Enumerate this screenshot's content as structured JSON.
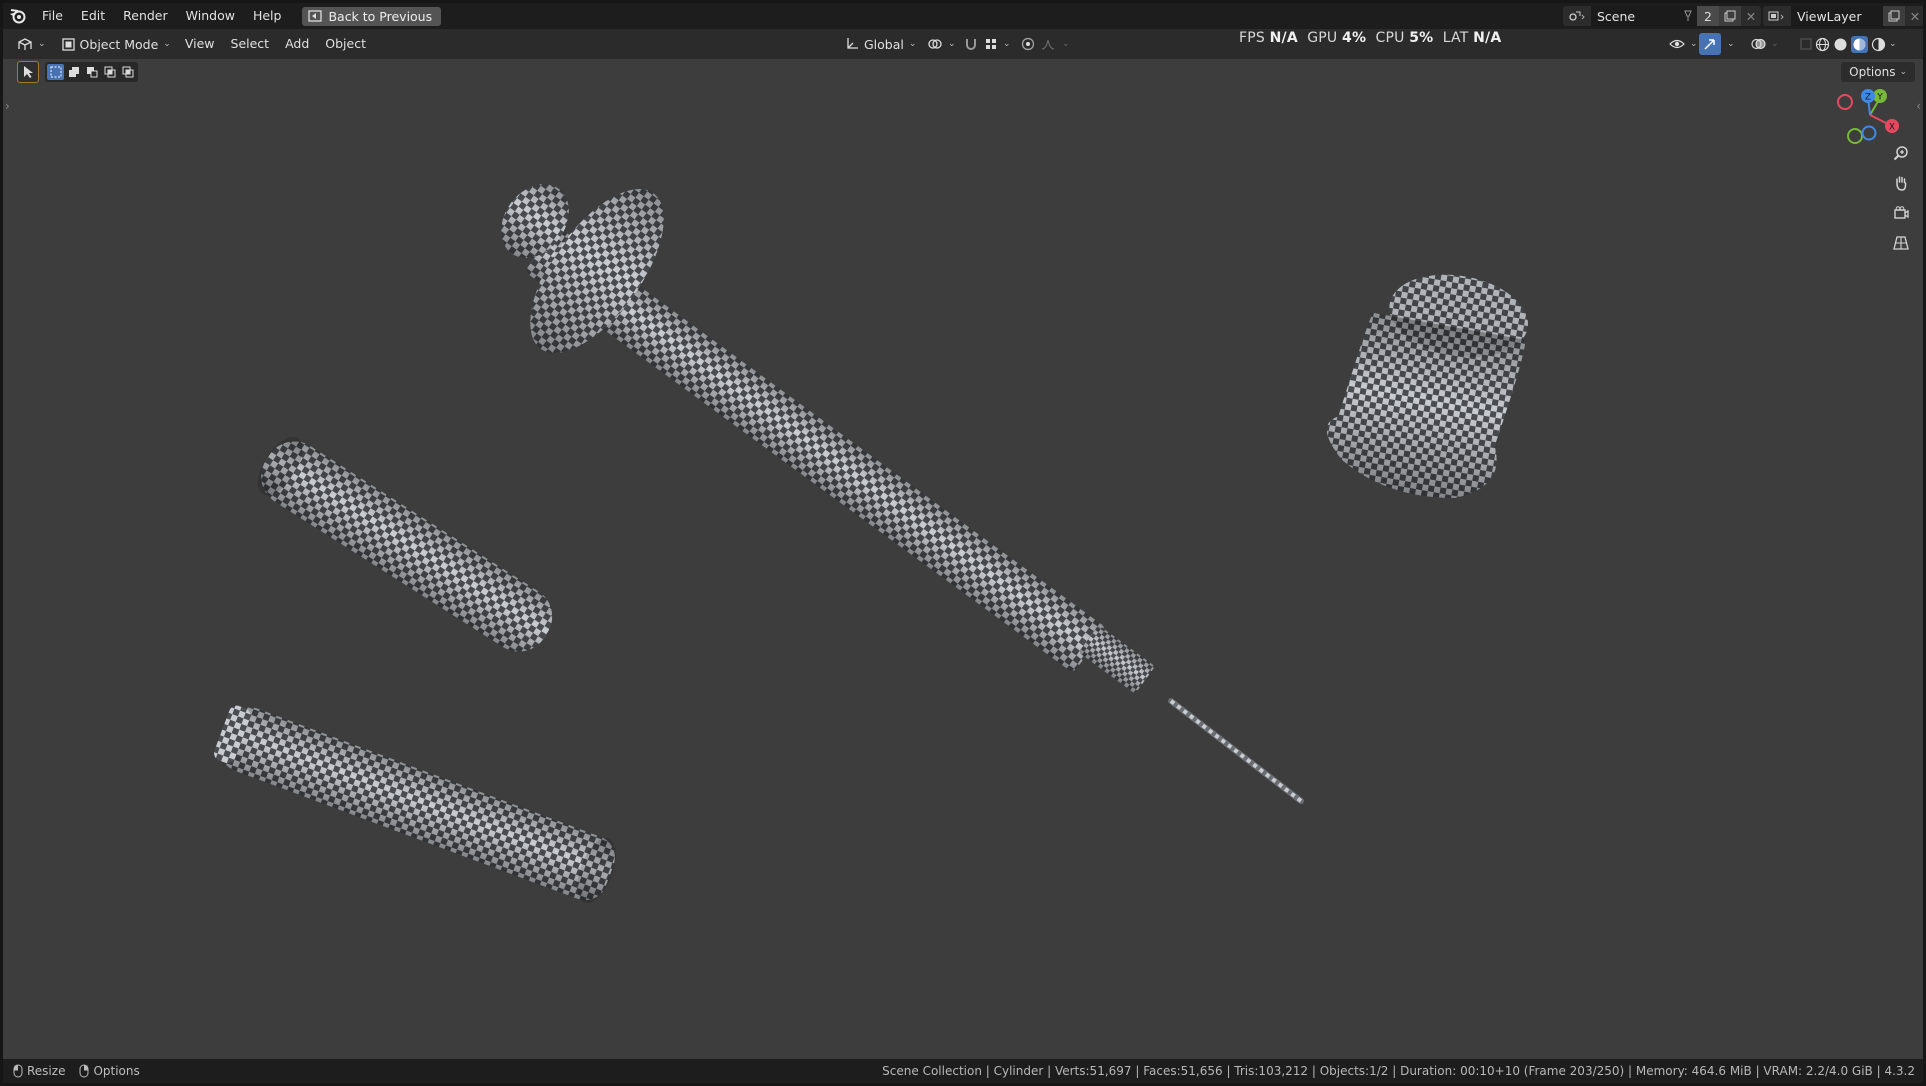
{
  "menubar": {
    "items": [
      "File",
      "Edit",
      "Render",
      "Window",
      "Help"
    ],
    "back_button": "Back to Previous",
    "scene": "Scene",
    "scene_users": "2",
    "view_layer": "ViewLayer"
  },
  "header": {
    "mode": "Object Mode",
    "menus": [
      "View",
      "Select",
      "Add",
      "Object"
    ],
    "orientation": "Global"
  },
  "stats": {
    "fps_label": "FPS",
    "fps_value": "N/A",
    "gpu_label": "GPU",
    "gpu_value": "4%",
    "cpu_label": "CPU",
    "cpu_value": "5%",
    "lat_label": "LAT",
    "lat_value": "N/A"
  },
  "viewport": {
    "options_label": "Options",
    "gizmo": {
      "x": "X",
      "y": "Y",
      "z": "Z"
    }
  },
  "statusbar": {
    "left": [
      "Resize",
      "Options"
    ],
    "info": "Scene Collection | Cylinder | Verts:51,697 | Faces:51,656 | Tris:103,212 | Objects:1/2 | Duration: 00:10+10 (Frame 203/250) | Memory: 464.6 MiB | VRAM: 2.2/4.0 GiB | 4.3.2"
  },
  "colors": {
    "accent_blue": "#4772b3",
    "axis_x": "#e8485f",
    "axis_y": "#78b83a",
    "axis_z": "#3f89e8",
    "viewport_bg": "#3d3d3d",
    "checker_light": "#c9ccd1",
    "checker_dark": "#4a4d52"
  }
}
